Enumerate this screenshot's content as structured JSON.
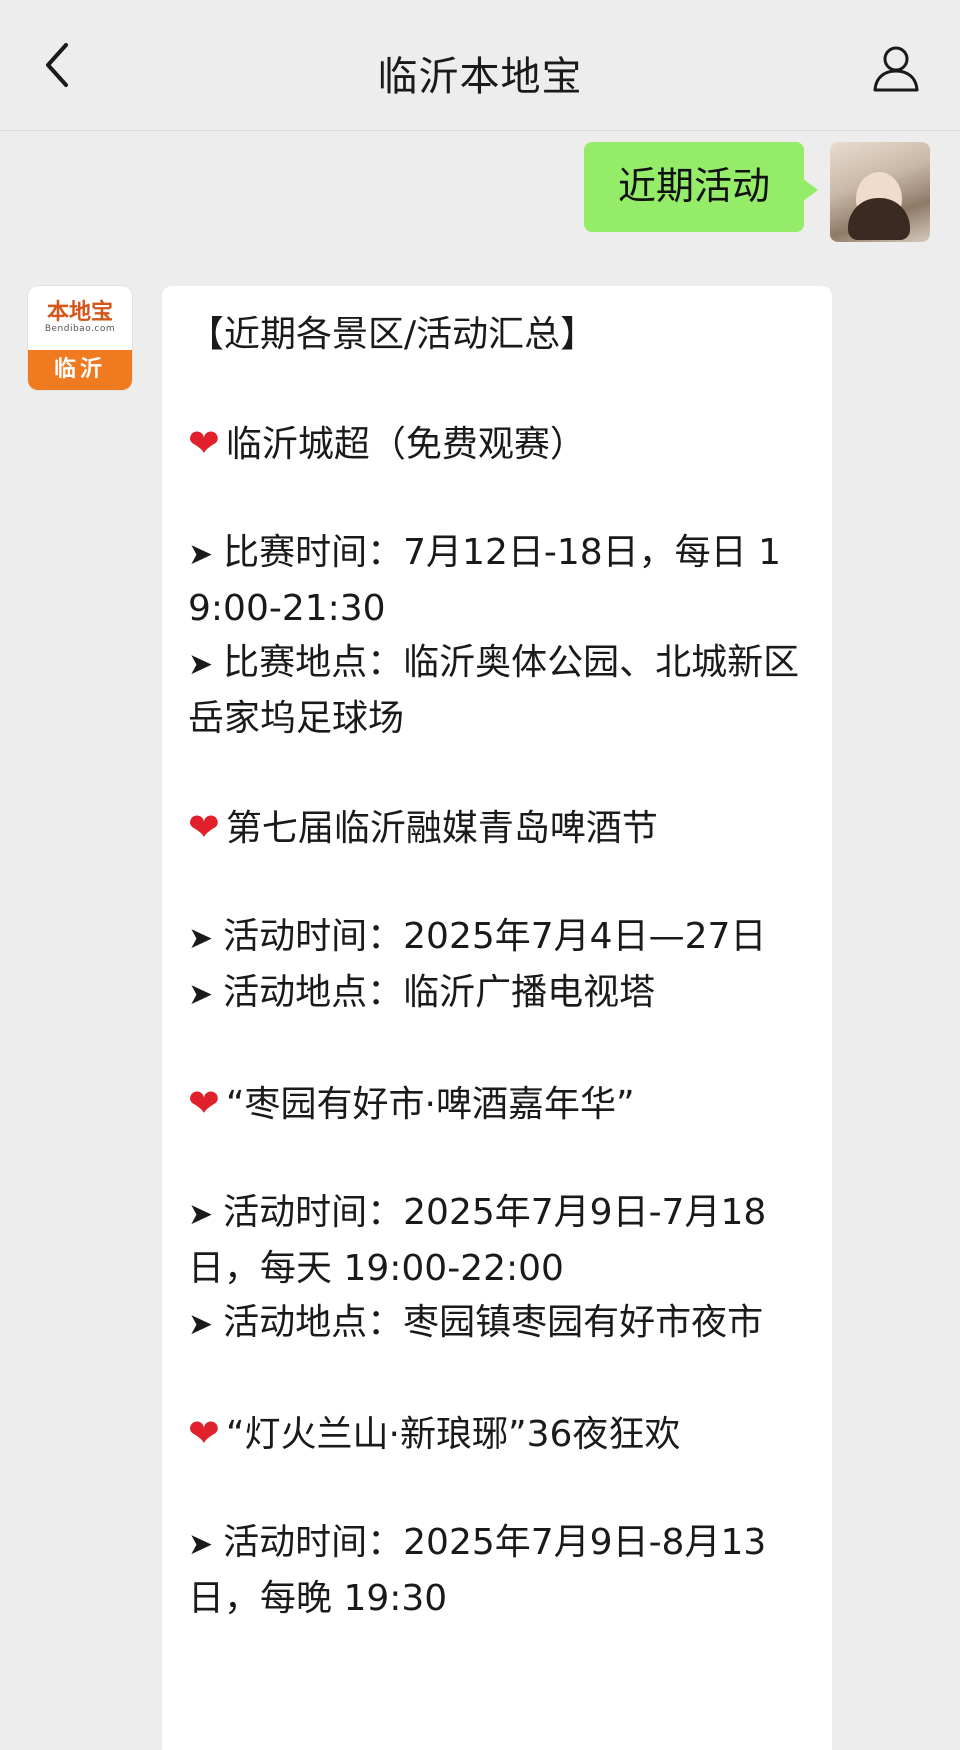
{
  "nav": {
    "title": "临沂本地宝",
    "back_icon": "chevron-left-icon",
    "profile_icon": "person-icon"
  },
  "outgoing": {
    "text": "近期活动"
  },
  "bot_avatar": {
    "logo_text": "本地宝",
    "logo_sub": "Bendibao.com",
    "city": "临沂"
  },
  "colors": {
    "outgoing_bubble": "#95ec69",
    "logo_orange": "#f07a1f",
    "heart_red": "#e0202a"
  },
  "message": {
    "header": "【近期各景区/活动汇总】",
    "sections": [
      {
        "title": "临沂城超（免费观赛）",
        "lines": [
          "比赛时间：7月12日-18日，每日 19:00-21:30",
          "比赛地点：临沂奥体公园、北城新区岳家坞足球场"
        ]
      },
      {
        "title": "第七届临沂融媒青岛啤酒节",
        "lines": [
          "活动时间：2025年7月4日—27日",
          "活动地点：临沂广播电视塔"
        ]
      },
      {
        "title": "“枣园有好市·啤酒嘉年华”",
        "lines": [
          "活动时间：2025年7月9日-7月18日，每天 19:00-22:00",
          "活动地点：枣园镇枣园有好市夜市"
        ]
      },
      {
        "title": "“灯火兰山·新琅琊”36夜狂欢",
        "lines": [
          "活动时间：2025年7月9日-8月13日，每晚 19:30"
        ]
      }
    ]
  }
}
